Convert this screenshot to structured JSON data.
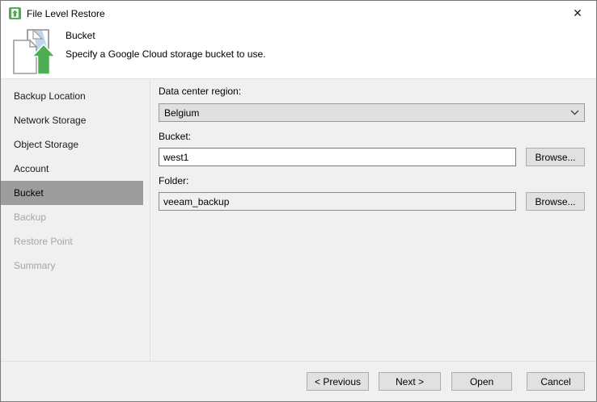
{
  "window": {
    "title": "File Level Restore"
  },
  "icons": {
    "close": "✕",
    "app": "veeam-file-restore",
    "header": "restore-documents-with-green-up-arrow",
    "combobox": "chevron-down"
  },
  "header": {
    "title": "Bucket",
    "description": "Specify a Google Cloud storage bucket to use."
  },
  "sidebar": {
    "items": [
      {
        "label": "Backup Location",
        "state": "done"
      },
      {
        "label": "Network Storage",
        "state": "done"
      },
      {
        "label": "Object Storage",
        "state": "done"
      },
      {
        "label": "Account",
        "state": "done"
      },
      {
        "label": "Bucket",
        "state": "current"
      },
      {
        "label": "Backup",
        "state": "upcoming"
      },
      {
        "label": "Restore Point",
        "state": "upcoming"
      },
      {
        "label": "Summary",
        "state": "upcoming"
      }
    ]
  },
  "form": {
    "region": {
      "label": "Data center region:",
      "value": "Belgium"
    },
    "bucket": {
      "label": "Bucket:",
      "value": "west1",
      "browse_label": "Browse..."
    },
    "folder": {
      "label": "Folder:",
      "value": "veeam_backup",
      "browse_label": "Browse..."
    }
  },
  "footer": {
    "previous_label": "< Previous",
    "next_label": "Next >",
    "open_label": "Open",
    "cancel_label": "Cancel"
  },
  "colors": {
    "accent_blue": "#0078d7",
    "veeam_green": "#4cae50",
    "selected_step_bg": "#9d9d9d",
    "fold_blue": "#bdd7ee"
  }
}
